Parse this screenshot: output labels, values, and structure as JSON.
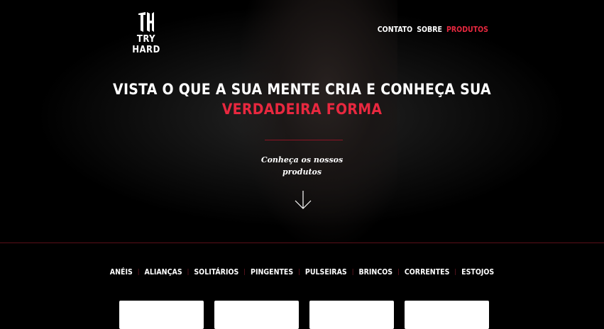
{
  "brand": {
    "name": "TRY HARD",
    "monogram": "TH",
    "accent_color": "#e8283f"
  },
  "nav": {
    "items": [
      {
        "label": "CONTATO",
        "active": false
      },
      {
        "label": "SOBRE",
        "active": false
      },
      {
        "label": "PRODUTOS",
        "active": true
      }
    ]
  },
  "hero": {
    "headline_line1": "VISTA O QUE A SUA MENTE CRIA E CONHEÇA SUA",
    "headline_line2": "VERDADEIRA FORMA",
    "cta_line1": "Conheça os nossos",
    "cta_line2": "produtos",
    "scroll_icon": "arrow-down-icon"
  },
  "categories": [
    "ANÉIS",
    "ALIANÇAS",
    "SOLITÁRIOS",
    "PINGENTES",
    "PULSEIRAS",
    "BRINCOS",
    "CORRENTES",
    "ESTOJOS"
  ]
}
